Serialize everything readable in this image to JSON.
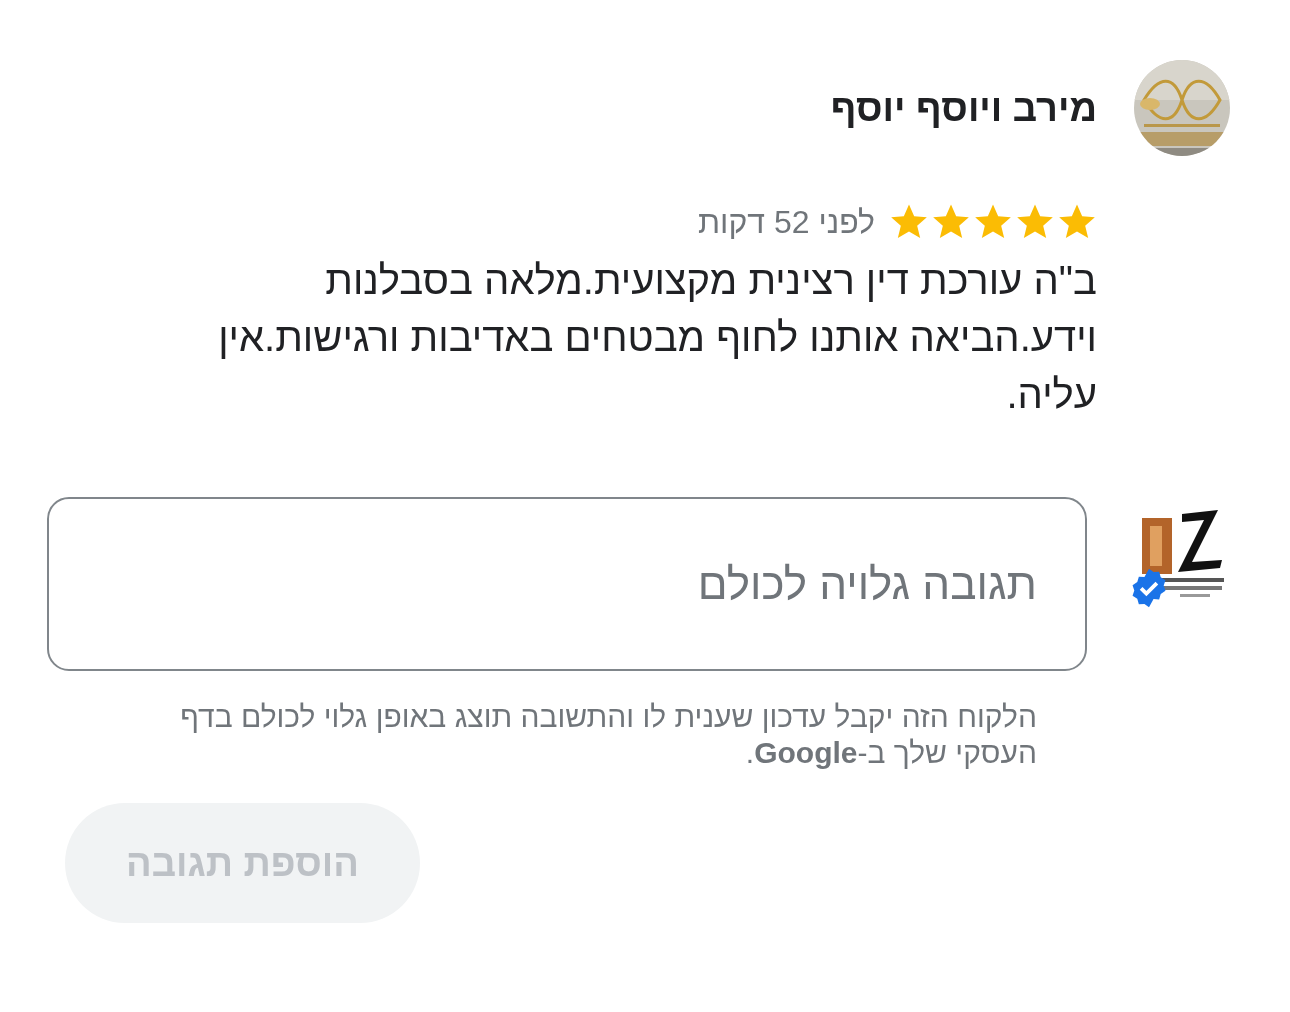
{
  "review": {
    "author": "מירב ויוסף יוסף",
    "avatar": {
      "kind": "picture"
    },
    "stars": 5,
    "time": "לפני 52 דקות",
    "text": "ב\"ה עורכת דין רצינית מקצועית.מלאה בסבלנות וידע.הביאה אותנו לחוף מבטחים באדיבות ורגישות.אין עליה."
  },
  "reply": {
    "avatar": {
      "kind": "picture",
      "verified": true
    },
    "placeholder": "תגובה גלויה לכולם",
    "hint": "הלקוח הזה יקבל עדכון שענית לו והתשובה תוצג באופן גלוי לכולם בדף העסקי שלך ב-**Google**.",
    "button": {
      "label": "הוספת תגובה",
      "disabled": true
    }
  }
}
